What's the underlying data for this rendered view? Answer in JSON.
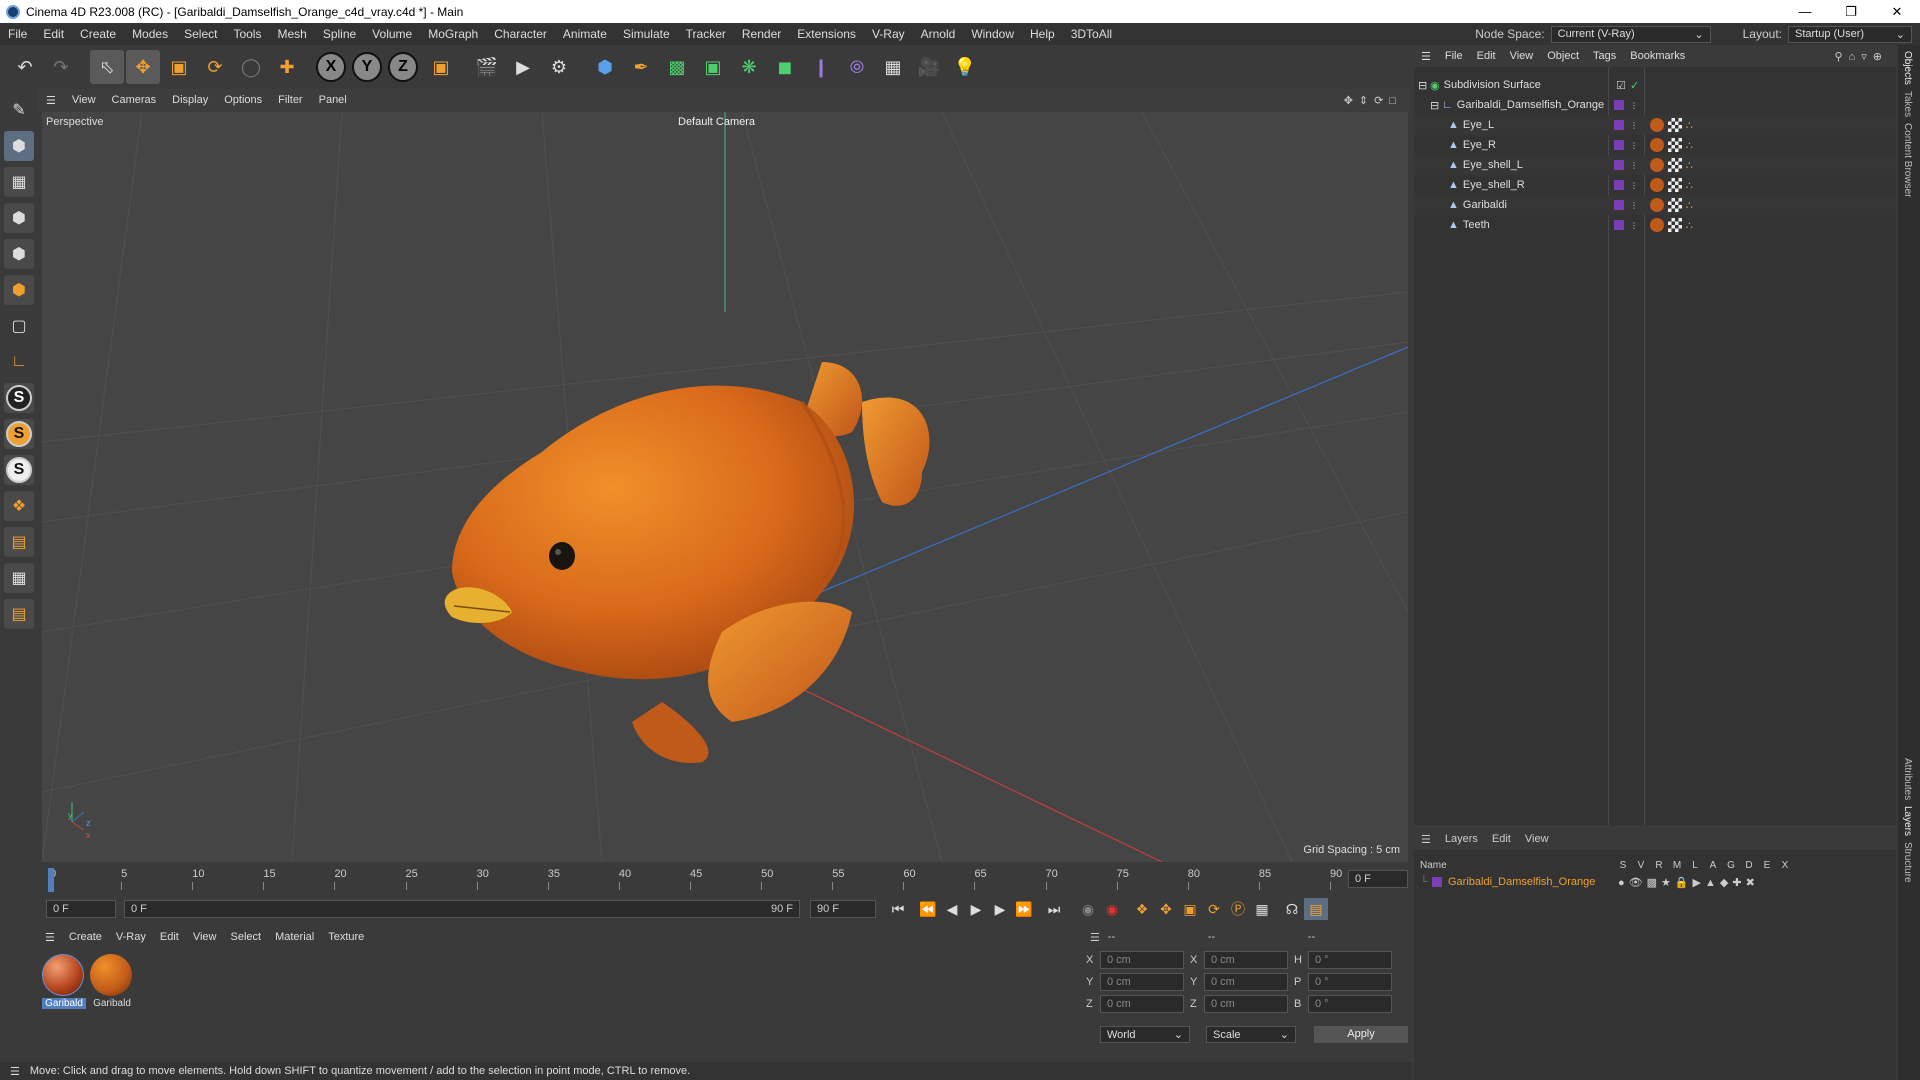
{
  "window": {
    "title": "Cinema 4D R23.008 (RC) - [Garibaldi_Damselfish_Orange_c4d_vray.c4d *] - Main"
  },
  "menu": [
    "File",
    "Edit",
    "Create",
    "Modes",
    "Select",
    "Tools",
    "Mesh",
    "Spline",
    "Volume",
    "MoGraph",
    "Character",
    "Animate",
    "Simulate",
    "Tracker",
    "Render",
    "Extensions",
    "V-Ray",
    "Arnold",
    "Window",
    "Help",
    "3DToAll"
  ],
  "nodespace": {
    "label": "Node Space:",
    "value": "Current (V-Ray)"
  },
  "layout": {
    "label": "Layout:",
    "value": "Startup (User)"
  },
  "viewport": {
    "menu": [
      "View",
      "Cameras",
      "Display",
      "Options",
      "Filter",
      "Panel"
    ],
    "label": "Perspective",
    "camera": "Default Camera",
    "grid": "Grid Spacing : 5 cm"
  },
  "timeline": {
    "ticks": [
      "0",
      "5",
      "10",
      "15",
      "20",
      "25",
      "30",
      "35",
      "40",
      "45",
      "50",
      "55",
      "60",
      "65",
      "70",
      "75",
      "80",
      "85",
      "90"
    ],
    "end_field": "0 F"
  },
  "transport": {
    "start": "0 F",
    "current": "0 F",
    "range_end": "90 F",
    "end": "90 F"
  },
  "materials": {
    "menu": [
      "Create",
      "V-Ray",
      "Edit",
      "View",
      "Select",
      "Material",
      "Texture"
    ],
    "items": [
      "Garibald",
      "Garibald"
    ]
  },
  "coords": {
    "headers": [
      "--",
      "--",
      "--"
    ],
    "rows": [
      {
        "a": "X",
        "av": "0 cm",
        "b": "X",
        "bv": "0 cm",
        "c": "H",
        "cv": "0 °"
      },
      {
        "a": "Y",
        "av": "0 cm",
        "b": "Y",
        "bv": "0 cm",
        "c": "P",
        "cv": "0 °"
      },
      {
        "a": "Z",
        "av": "0 cm",
        "b": "Z",
        "bv": "0 cm",
        "c": "B",
        "cv": "0 °"
      }
    ],
    "world": "World",
    "scale": "Scale",
    "apply": "Apply"
  },
  "status": "Move: Click and drag to move elements. Hold down SHIFT to quantize movement / add to the selection in point mode, CTRL to remove.",
  "objects": {
    "menu": [
      "File",
      "Edit",
      "View",
      "Object",
      "Tags",
      "Bookmarks"
    ],
    "root": "Subdivision Surface",
    "group": "Garibaldi_Damselfish_Orange",
    "children": [
      "Eye_L",
      "Eye_R",
      "Eye_shell_L",
      "Eye_shell_R",
      "Garibaldi",
      "Teeth"
    ]
  },
  "layers": {
    "menu": [
      "Layers",
      "Edit",
      "View"
    ],
    "name_header": "Name",
    "cols": [
      "S",
      "V",
      "R",
      "M",
      "L",
      "A",
      "G",
      "D",
      "E",
      "X"
    ],
    "item": "Garibaldi_Damselfish_Orange"
  },
  "side_tabs": [
    "Objects",
    "Takes",
    "Content Browser",
    "Attributes",
    "Layers",
    "Structure"
  ],
  "colors": {
    "accent": "#4f7fbf",
    "layer": "#7a3fb5",
    "fish": "#e07a1c"
  }
}
